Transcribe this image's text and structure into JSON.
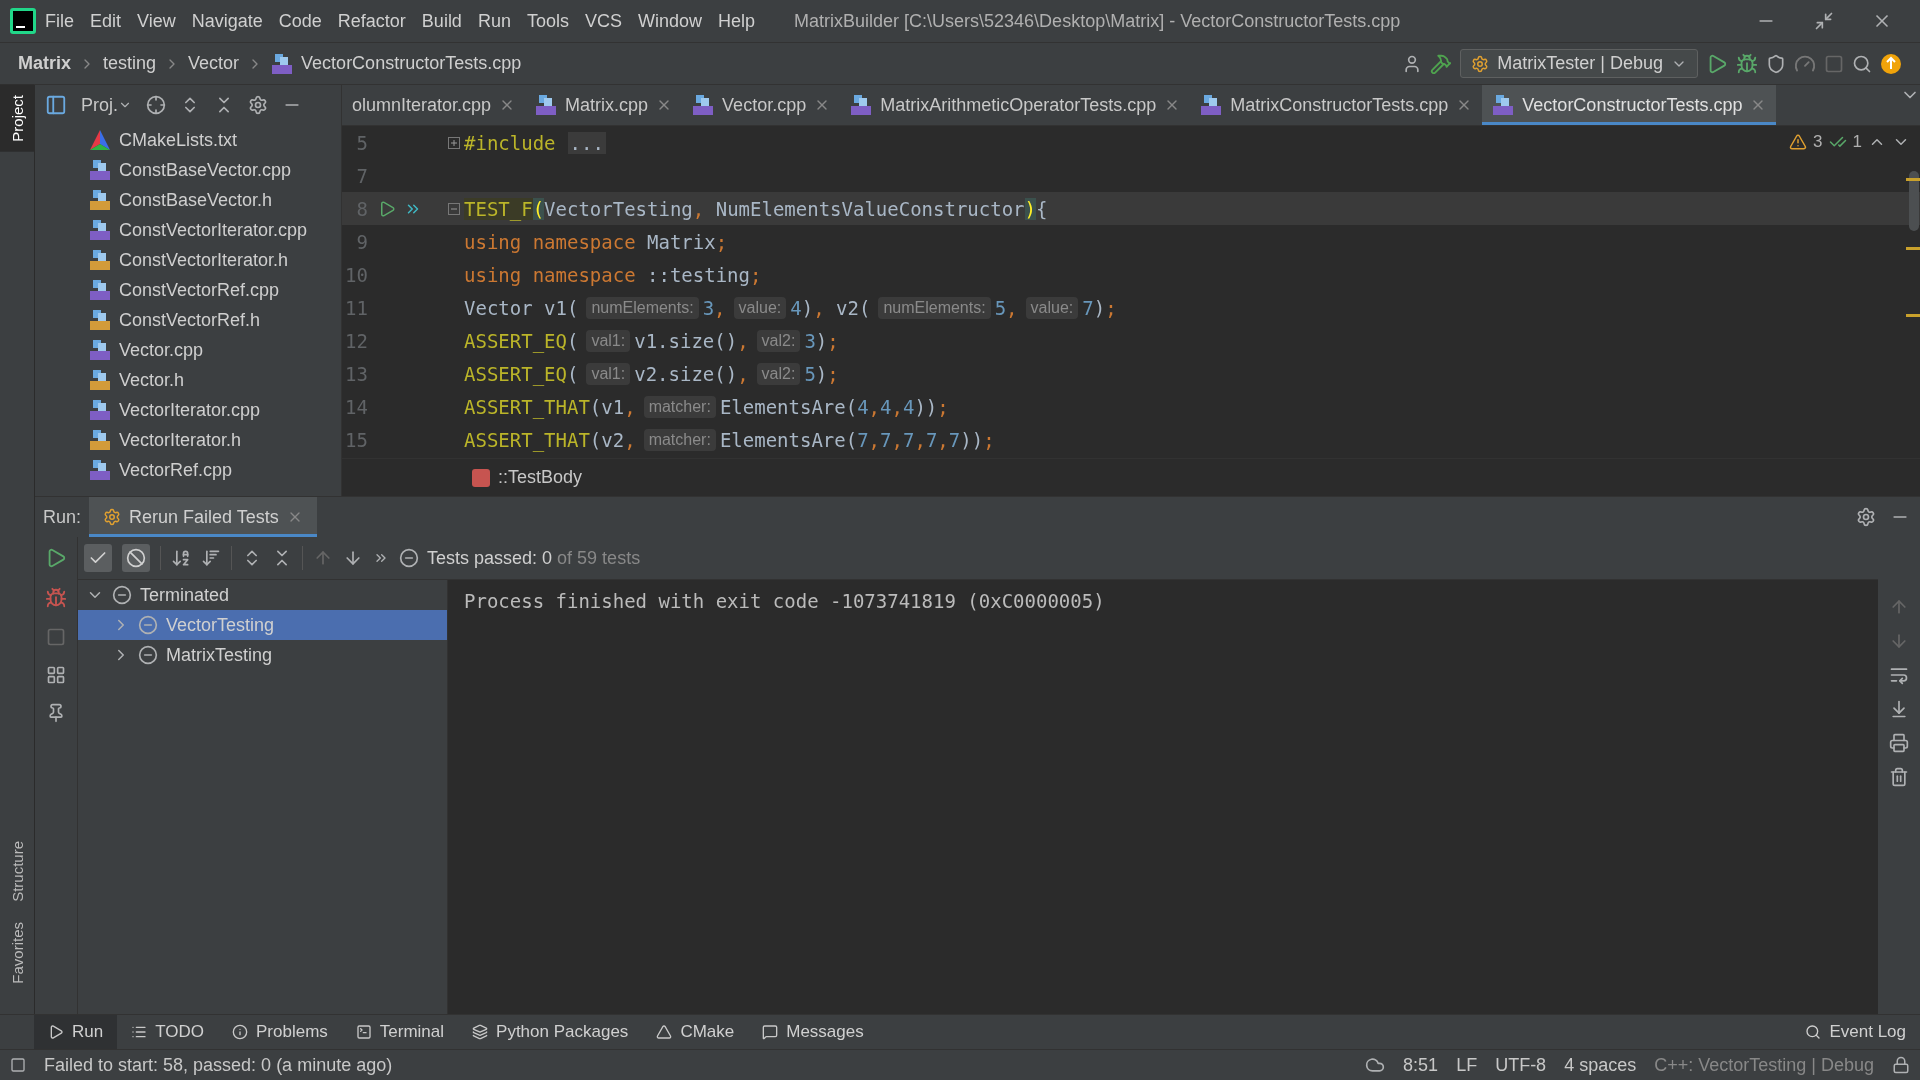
{
  "menu": [
    "File",
    "Edit",
    "View",
    "Navigate",
    "Code",
    "Refactor",
    "Build",
    "Run",
    "Tools",
    "VCS",
    "Window",
    "Help"
  ],
  "window": {
    "title": "MatrixBuilder [C:\\Users\\52346\\Desktop\\Matrix] - VectorConstructorTests.cpp"
  },
  "breadcrumbs": [
    "Matrix",
    "testing",
    "Vector",
    "VectorConstructorTests.cpp"
  ],
  "run_config": "MatrixTester | Debug",
  "side_tabs": [
    {
      "label": "Project",
      "selected": true
    },
    {
      "label": "Structure",
      "selected": false
    },
    {
      "label": "Favorites",
      "selected": false
    }
  ],
  "project": {
    "title": "Proj.",
    "items": [
      {
        "name": "CMakeLists.txt",
        "kind": "cmake"
      },
      {
        "name": "ConstBaseVector.cpp",
        "kind": "cpp"
      },
      {
        "name": "ConstBaseVector.h",
        "kind": "h"
      },
      {
        "name": "ConstVectorIterator.cpp",
        "kind": "cpp"
      },
      {
        "name": "ConstVectorIterator.h",
        "kind": "h"
      },
      {
        "name": "ConstVectorRef.cpp",
        "kind": "cpp"
      },
      {
        "name": "ConstVectorRef.h",
        "kind": "h"
      },
      {
        "name": "Vector.cpp",
        "kind": "cpp"
      },
      {
        "name": "Vector.h",
        "kind": "h"
      },
      {
        "name": "VectorIterator.cpp",
        "kind": "cpp"
      },
      {
        "name": "VectorIterator.h",
        "kind": "h"
      },
      {
        "name": "VectorRef.cpp",
        "kind": "cpp"
      }
    ]
  },
  "tabs": [
    {
      "label": "olumnIterator.cpp",
      "selected": false
    },
    {
      "label": "Matrix.cpp",
      "selected": false
    },
    {
      "label": "Vector.cpp",
      "selected": false
    },
    {
      "label": "MatrixArithmeticOperatorTests.cpp",
      "selected": false
    },
    {
      "label": "MatrixConstructorTests.cpp",
      "selected": false
    },
    {
      "label": "VectorConstructorTests.cpp",
      "selected": true
    }
  ],
  "inspections": {
    "warnings": "3",
    "ok": "1"
  },
  "code": [
    {
      "number": "5",
      "folded": true,
      "current": false,
      "run": false,
      "tokens": [
        {
          "kind": "macro",
          "text": "#include"
        },
        {
          "kind": "fold",
          "text": "..."
        }
      ]
    },
    {
      "number": "7",
      "current": false,
      "run": false
    },
    {
      "number": "8",
      "folded": false,
      "current": true,
      "run": true,
      "tokens": [
        {
          "kind": "macrohl",
          "text": "TEST_F"
        },
        {
          "kind": "brace",
          "text": "("
        },
        {
          "kind": "id",
          "text": "VectorTesting"
        },
        {
          "kind": "punct",
          "text": ", "
        },
        {
          "kind": "id",
          "text": "NumElementsValueConstructor"
        },
        {
          "kind": "brace",
          "text": ")"
        },
        {
          "kind": "id",
          "text": "{"
        }
      ]
    },
    {
      "number": "9",
      "current": false,
      "run": false,
      "tokens": [
        {
          "kind": "kw",
          "text": "using namespace "
        },
        {
          "kind": "id",
          "text": "Matrix"
        },
        {
          "kind": "punct",
          "text": ";"
        }
      ]
    },
    {
      "number": "10",
      "current": false,
      "run": false,
      "tokens": [
        {
          "kind": "kw",
          "text": "using namespace "
        },
        {
          "kind": "id",
          "text": "::testing"
        },
        {
          "kind": "punct",
          "text": ";"
        }
      ]
    },
    {
      "number": "11",
      "current": false,
      "run": false,
      "tokens": [
        {
          "kind": "id",
          "text": "Vector v1("
        },
        {
          "kind": "hint",
          "text": "numElements:"
        },
        {
          "kind": "num",
          "text": "3"
        },
        {
          "kind": "punct",
          "text": ","
        },
        {
          "kind": "hint",
          "text": "value:"
        },
        {
          "kind": "num",
          "text": "4"
        },
        {
          "kind": "id",
          "text": ")"
        },
        {
          "kind": "punct",
          "text": ", "
        },
        {
          "kind": "id",
          "text": "v2("
        },
        {
          "kind": "hint",
          "text": "numElements:"
        },
        {
          "kind": "num",
          "text": "5"
        },
        {
          "kind": "punct",
          "text": ","
        },
        {
          "kind": "hint",
          "text": "value:"
        },
        {
          "kind": "num",
          "text": "7"
        },
        {
          "kind": "id",
          "text": ")"
        },
        {
          "kind": "punct",
          "text": ";"
        }
      ]
    },
    {
      "number": "12",
      "current": false,
      "run": false,
      "tokens": [
        {
          "kind": "macro",
          "text": "ASSERT_EQ"
        },
        {
          "kind": "id",
          "text": "("
        },
        {
          "kind": "hint",
          "text": "val1:"
        },
        {
          "kind": "id",
          "text": "v1.size()"
        },
        {
          "kind": "punct",
          "text": ","
        },
        {
          "kind": "hint",
          "text": "val2:"
        },
        {
          "kind": "num",
          "text": "3"
        },
        {
          "kind": "id",
          "text": ")"
        },
        {
          "kind": "punct",
          "text": ";"
        }
      ]
    },
    {
      "number": "13",
      "current": false,
      "run": false,
      "tokens": [
        {
          "kind": "macro",
          "text": "ASSERT_EQ"
        },
        {
          "kind": "id",
          "text": "("
        },
        {
          "kind": "hint",
          "text": "val1:"
        },
        {
          "kind": "id",
          "text": "v2.size()"
        },
        {
          "kind": "punct",
          "text": ","
        },
        {
          "kind": "hint",
          "text": "val2:"
        },
        {
          "kind": "num",
          "text": "5"
        },
        {
          "kind": "id",
          "text": ")"
        },
        {
          "kind": "punct",
          "text": ";"
        }
      ]
    },
    {
      "number": "14",
      "current": false,
      "run": false,
      "tokens": [
        {
          "kind": "macro",
          "text": "ASSERT_THAT"
        },
        {
          "kind": "id",
          "text": "(v1"
        },
        {
          "kind": "punct",
          "text": ","
        },
        {
          "kind": "hint",
          "text": "matcher:"
        },
        {
          "kind": "id",
          "text": "ElementsAre("
        },
        {
          "kind": "num",
          "text": "4"
        },
        {
          "kind": "punct",
          "text": ","
        },
        {
          "kind": "num",
          "text": "4"
        },
        {
          "kind": "punct",
          "text": ","
        },
        {
          "kind": "num",
          "text": "4"
        },
        {
          "kind": "id",
          "text": "))"
        },
        {
          "kind": "punct",
          "text": ";"
        }
      ]
    },
    {
      "number": "15",
      "current": false,
      "run": false,
      "tokens": [
        {
          "kind": "macro",
          "text": "ASSERT_THAT"
        },
        {
          "kind": "id",
          "text": "(v2"
        },
        {
          "kind": "punct",
          "text": ","
        },
        {
          "kind": "hint",
          "text": "matcher:"
        },
        {
          "kind": "id",
          "text": "ElementsAre("
        },
        {
          "kind": "num",
          "text": "7"
        },
        {
          "kind": "punct",
          "text": ","
        },
        {
          "kind": "num",
          "text": "7"
        },
        {
          "kind": "punct",
          "text": ","
        },
        {
          "kind": "num",
          "text": "7"
        },
        {
          "kind": "punct",
          "text": ","
        },
        {
          "kind": "num",
          "text": "7"
        },
        {
          "kind": "punct",
          "text": ","
        },
        {
          "kind": "num",
          "text": "7"
        },
        {
          "kind": "id",
          "text": "))"
        },
        {
          "kind": "punct",
          "text": ";"
        }
      ]
    }
  ],
  "editor_breadcrumb": "::TestBody",
  "run": {
    "label": "Run:",
    "tabs": [
      {
        "label": "Rerun Failed Tests",
        "selected": true
      }
    ],
    "toggles": {
      "show_passed": true,
      "show_ignored": true
    },
    "status": "Tests passed: 0",
    "status_total": " of 59 tests",
    "tree": [
      {
        "label": "Terminated",
        "expanded": true,
        "selected": false,
        "children": [
          {
            "label": "VectorTesting",
            "expanded": false,
            "selected": true
          },
          {
            "label": "MatrixTesting",
            "expanded": false,
            "selected": false
          }
        ]
      }
    ],
    "console": "Process finished with exit code -1073741819 (0xC0000005)"
  },
  "tool_tabs": [
    {
      "label": "Run",
      "selected": true,
      "kind": "run"
    },
    {
      "label": "TODO",
      "selected": false,
      "kind": "todo"
    },
    {
      "label": "Problems",
      "selected": false,
      "kind": "problems"
    },
    {
      "label": "Terminal",
      "selected": false,
      "kind": "terminal"
    },
    {
      "label": "Python Packages",
      "selected": false,
      "kind": "packages"
    },
    {
      "label": "CMake",
      "selected": false,
      "kind": "cmake"
    },
    {
      "label": "Messages",
      "selected": false,
      "kind": "messages"
    }
  ],
  "event_log": "Event Log",
  "status_bar": {
    "message": "Failed to start: 58, passed: 0 (a minute ago)",
    "items": [
      "8:51",
      "LF",
      "UTF-8",
      "4 spaces"
    ],
    "context": "C++: VectorTesting | Debug"
  }
}
